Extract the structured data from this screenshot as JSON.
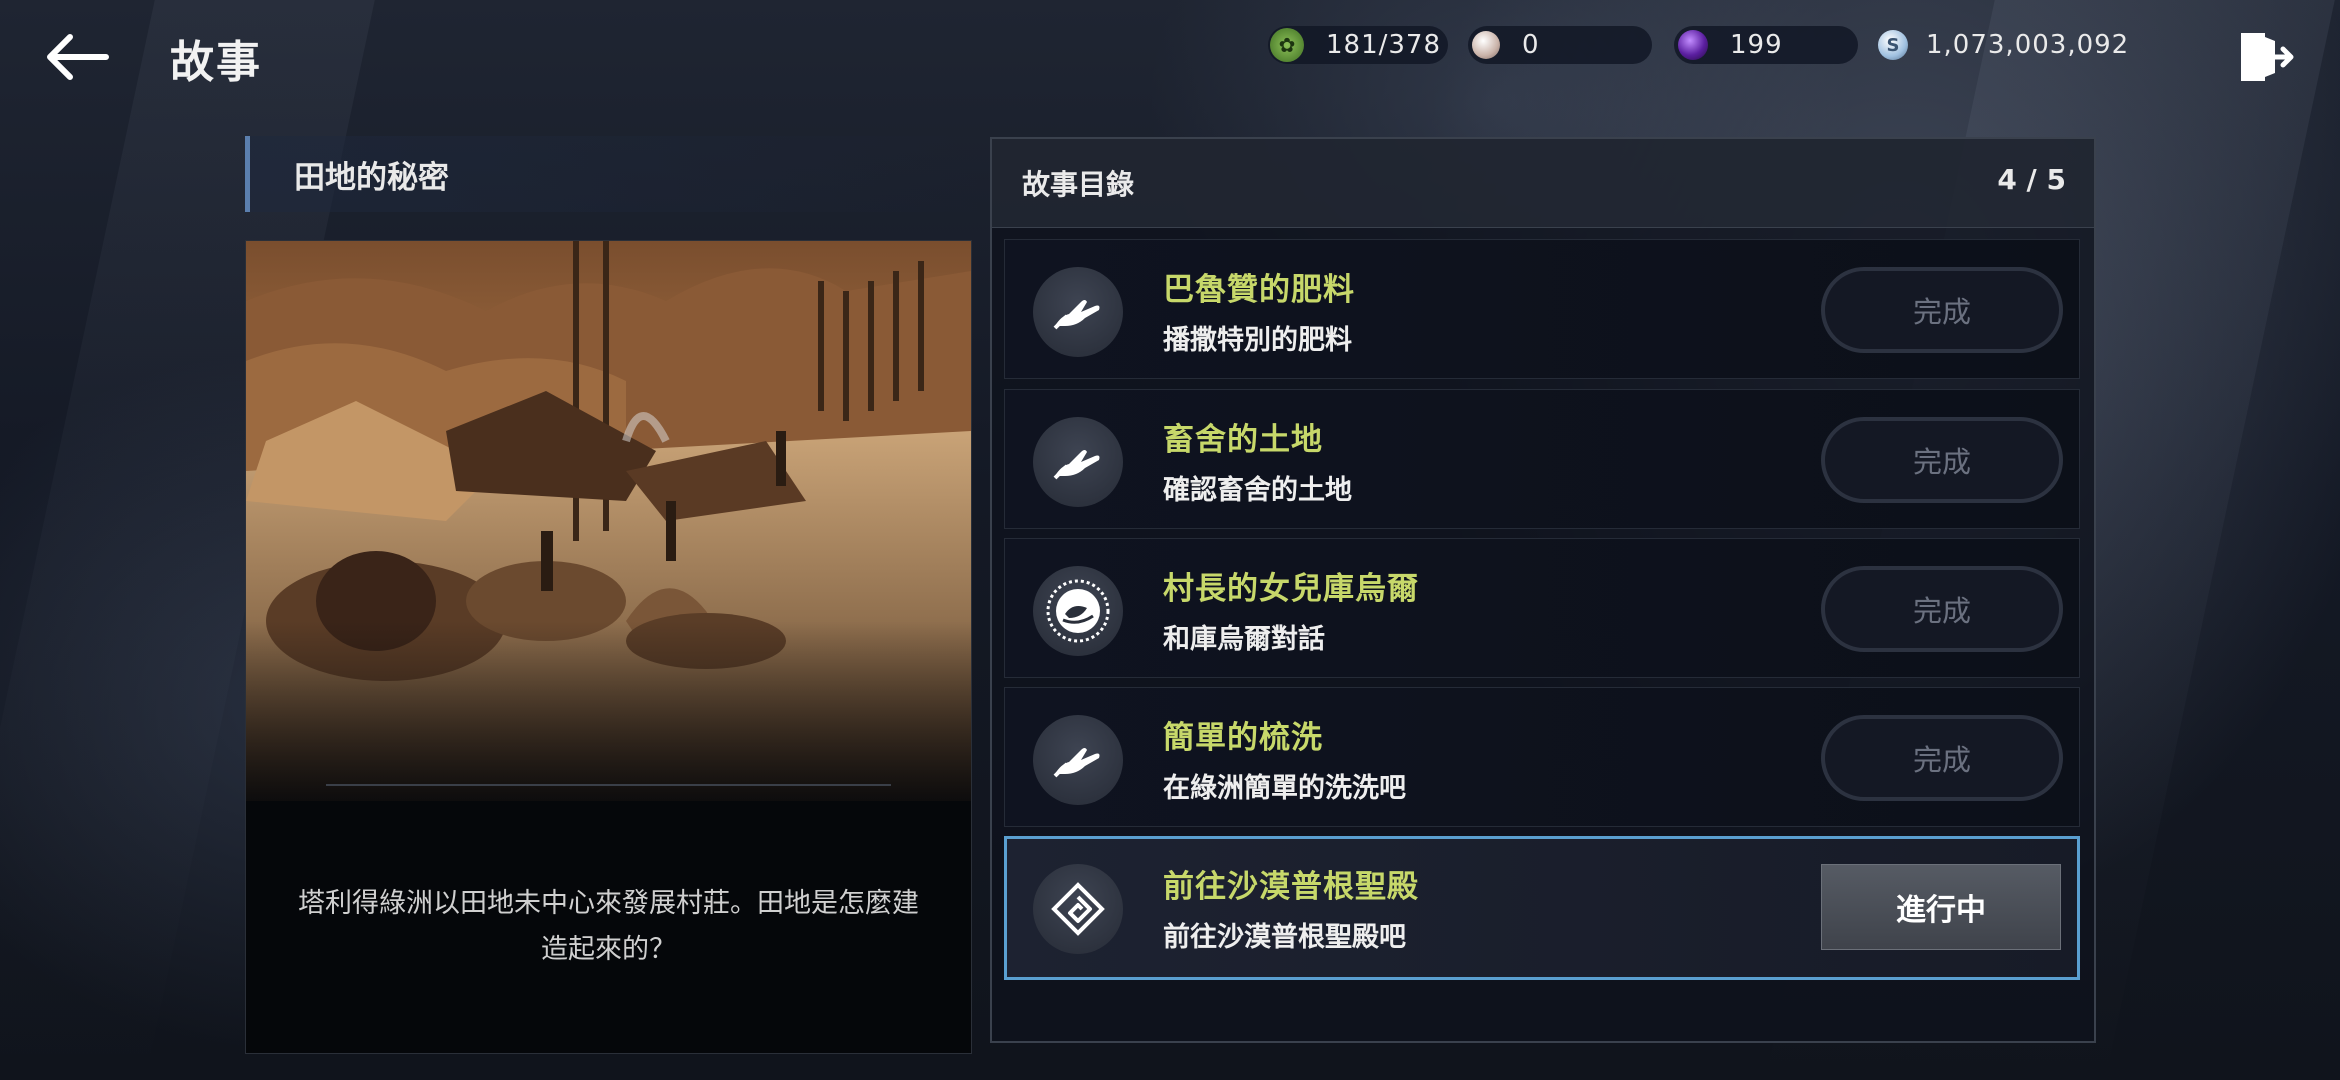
{
  "header": {
    "title": "故事",
    "currencies": [
      {
        "icon": "energy-icon",
        "value": "181/378",
        "color": "#5e9a3a"
      },
      {
        "icon": "pearl-icon",
        "value": "0",
        "color": "#d9c9c0"
      },
      {
        "icon": "purple-orb-icon",
        "value": "199",
        "color": "#6a2ab0"
      },
      {
        "icon": "silver-coin-icon",
        "value": "1,073,003,092",
        "color": "#bcd4ec"
      }
    ]
  },
  "story": {
    "chapter_title": "田地的秘密",
    "description": "塔利得綠洲以田地未中心來發展村莊。田地是怎麼建造起來的？"
  },
  "quest_list": {
    "title": "故事目錄",
    "count": "4 / 5",
    "items": [
      {
        "title": "巴魯贊的肥料",
        "subtitle": "播撒特別的肥料",
        "icon": "hand-icon",
        "status": "完成"
      },
      {
        "title": "畜舍的土地",
        "subtitle": "確認畜舍的土地",
        "icon": "hand-icon",
        "status": "完成"
      },
      {
        "title": "村長的女兒庫烏爾",
        "subtitle": "和庫烏爾對話",
        "icon": "speech-icon",
        "status": "完成"
      },
      {
        "title": "簡單的梳洗",
        "subtitle": "在綠洲簡單的洗洗吧",
        "icon": "hand-icon",
        "status": "完成"
      },
      {
        "title": "前往沙漠普根聖殿",
        "subtitle": "前往沙漠普根聖殿吧",
        "icon": "waypoint-icon",
        "status": "進行中"
      }
    ]
  },
  "colors": {
    "quest_title": "#c7d86a",
    "active_border": "#5a9fd0",
    "chapter_accent": "#5b7fae"
  }
}
